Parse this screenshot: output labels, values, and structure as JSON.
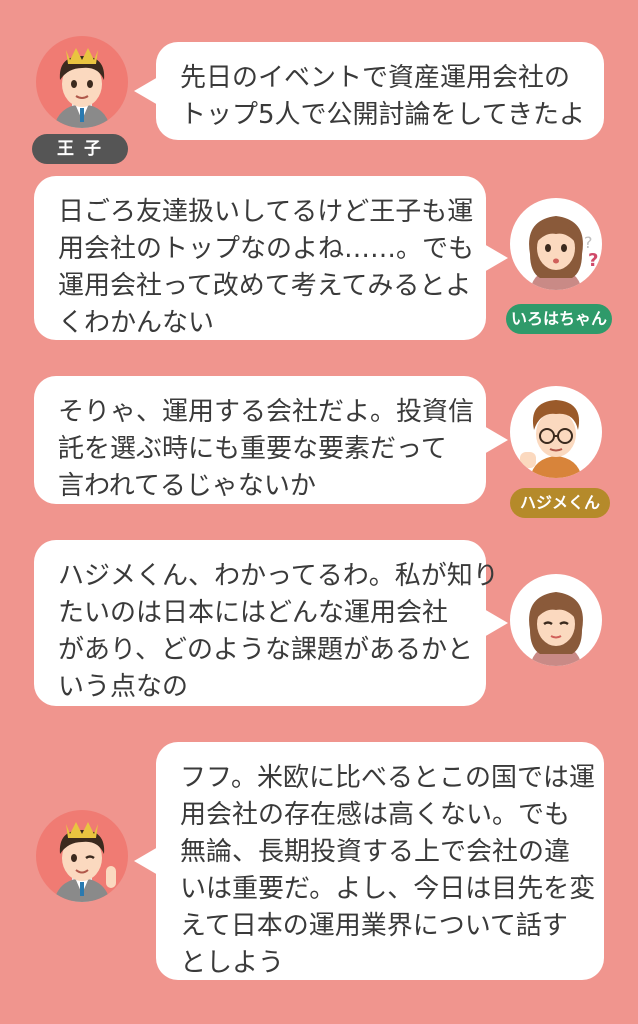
{
  "colors": {
    "background": "#f0958e",
    "bubble": "#ffffff",
    "tag_prince": "#555555",
    "tag_iroha": "#2f9a6a",
    "tag_hajime": "#b58a2a"
  },
  "messages": [
    {
      "speaker": "prince",
      "name_tag": "王 子",
      "lines": [
        "先日のイベントで資産運用会社の",
        "トップ5人で公開討論をしてきたよ"
      ]
    },
    {
      "speaker": "iroha",
      "name_tag": "いろはちゃん",
      "lines": [
        "日ごろ友達扱いしてるけど王子も運",
        "用会社のトップなのよね……。でも",
        "運用会社って改めて考えてみるとよ",
        "くわかんない"
      ]
    },
    {
      "speaker": "hajime",
      "name_tag": "ハジメくん",
      "lines": [
        "そりゃ、運用する会社だよ。投資信",
        "託を選ぶ時にも重要な要素だって",
        "言われてるじゃないか"
      ]
    },
    {
      "speaker": "iroha",
      "name_tag": "",
      "lines": [
        "ハジメくん、わかってるわ。私が知り",
        "たいのは日本にはどんな運用会社",
        "があり、どのような課題があるかと",
        "いう点なの"
      ]
    },
    {
      "speaker": "prince",
      "name_tag": "",
      "lines": [
        "フフ。米欧に比べるとこの国では運",
        "用会社の存在感は高くない。でも",
        "無論、長期投資する上で会社の違",
        "いは重要だ。よし、今日は目先を変",
        "えて日本の運用業界について話す",
        "としよう"
      ]
    }
  ]
}
